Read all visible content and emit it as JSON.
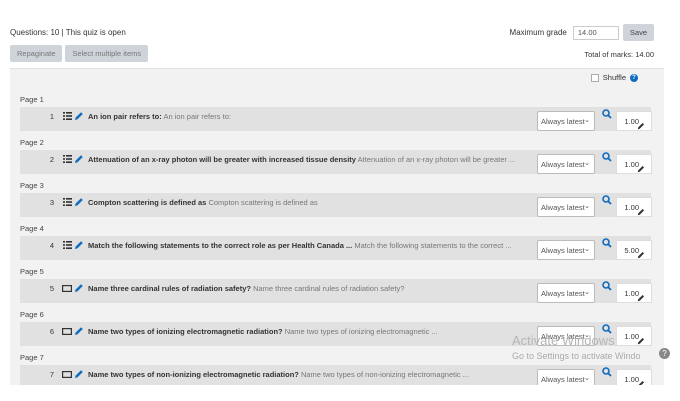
{
  "header": {
    "questions_info": "Questions: 10 | This quiz is open",
    "max_grade_label": "Maximum grade",
    "max_grade_value": "14.00",
    "save_label": "Save"
  },
  "toolbar": {
    "repaginate_label": "Repaginate",
    "select_multiple_label": "Select multiple items",
    "total_marks": "Total of marks: 14.00"
  },
  "shuffle_label": "Shuffle",
  "help_glyph": "?",
  "select_arrow": "⌄",
  "slots": [
    {
      "page": "Page 1",
      "num": "1",
      "type": "list",
      "title": "An ion pair refers to:",
      "preview": "An ion pair refers to:",
      "version": "Always latest",
      "mark": "1.00"
    },
    {
      "page": "Page 2",
      "num": "2",
      "type": "list",
      "title": "Attenuation of an x-ray photon will be greater with increased tissue density",
      "preview": "Attenuation of an x-ray photon will be greater ...",
      "version": "Always latest",
      "mark": "1.00"
    },
    {
      "page": "Page 3",
      "num": "3",
      "type": "list",
      "title": "Compton scattering is defined as",
      "preview": "Compton scattering is defined as",
      "version": "Always latest",
      "mark": "1.00"
    },
    {
      "page": "Page 4",
      "num": "4",
      "type": "list",
      "title": "Match the following statements to the correct role as per Health Canada ...",
      "preview": "Match the following statements to the correct ...",
      "version": "Always latest",
      "mark": "5.00"
    },
    {
      "page": "Page 5",
      "num": "5",
      "type": "essay",
      "title": "Name three cardinal rules of radiation safety?",
      "preview": "Name three cardinal rules of radiation safety?",
      "version": "Always latest",
      "mark": "1.00"
    },
    {
      "page": "Page 6",
      "num": "6",
      "type": "essay",
      "title": "Name two types of ionizing electromagnetic radiation?",
      "preview": "Name two types of ionizing electromagnetic ...",
      "version": "Always latest",
      "mark": "1.00"
    },
    {
      "page": "Page 7",
      "num": "7",
      "type": "essay",
      "title": "Name two types of non-ionizing electromagnetic radiation?",
      "preview": "Name two types of non-ionizing electromagnetic ...",
      "version": "Always latest",
      "mark": "1.00"
    }
  ],
  "watermark": {
    "line1": "Activate Windows",
    "line2": "Go to Settings to activate Windo"
  },
  "scroll_glyph": "?",
  "colors": {
    "accent": "#0f6cbf",
    "slot_bg": "#e1e1e1",
    "panel_bg": "#f2f2f2"
  }
}
